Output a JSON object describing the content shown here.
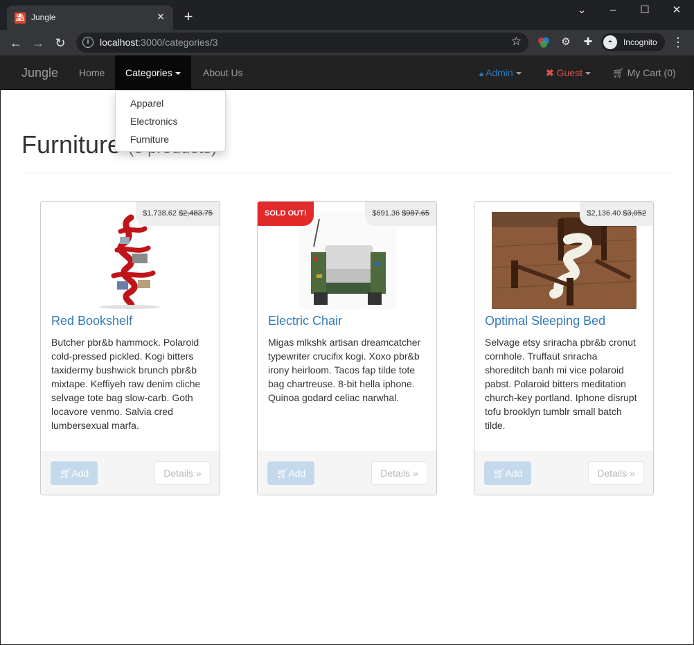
{
  "browser": {
    "tab_title": "Jungle",
    "url_host": "localhost",
    "url_path": ":3000/categories/3",
    "profile_label": "Incognito"
  },
  "navbar": {
    "brand": "Jungle",
    "home": "Home",
    "categories": "Categories",
    "about": "About Us",
    "admin": "Admin",
    "guest": "Guest",
    "cart": "My Cart (0)"
  },
  "dropdown": {
    "items": [
      "Apparel",
      "Electronics",
      "Furniture"
    ]
  },
  "header": {
    "title": "Furniture",
    "subtitle": "(3 products)"
  },
  "products": [
    {
      "name": "Red Bookshelf",
      "price": "$1,738.62",
      "old_price": "$2,483.75",
      "sold_out": false,
      "description": "Butcher pbr&b hammock. Polaroid cold-pressed pickled. Kogi bitters taxidermy bushwick brunch pbr&b mixtape. Keffiyeh raw denim cliche selvage tote bag slow-carb. Goth locavore venmo. Salvia cred lumbersexual marfa.",
      "add_label": "Add",
      "details_label": "Details »"
    },
    {
      "name": "Electric Chair",
      "price": "$691.36",
      "old_price": "$987.65",
      "sold_out": true,
      "sold_out_label": "SOLD OUT!",
      "description": "Migas mlkshk artisan dreamcatcher typewriter crucifix kogi. Xoxo pbr&b irony heirloom. Tacos fap tilde tote bag chartreuse. 8-bit hella iphone. Quinoa godard celiac narwhal.",
      "add_label": "Add",
      "details_label": "Details »"
    },
    {
      "name": "Optimal Sleeping Bed",
      "price": "$2,136.40",
      "old_price": "$3,052",
      "sold_out": false,
      "description": "Selvage etsy sriracha pbr&b cronut cornhole. Truffaut sriracha shoreditch banh mi vice polaroid pabst. Polaroid bitters meditation church-key portland. Iphone disrupt tofu brooklyn tumblr small batch tilde.",
      "add_label": "Add",
      "details_label": "Details »"
    }
  ],
  "colors": {
    "link": "#337ab7",
    "sold_out": "#e22a2a",
    "navbar": "#222222"
  }
}
